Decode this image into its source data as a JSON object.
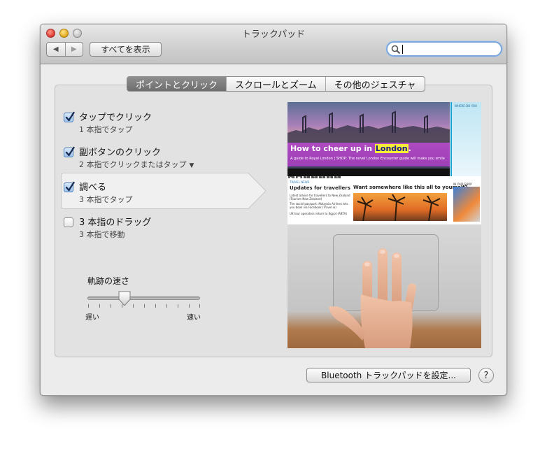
{
  "window": {
    "title": "トラックパッド"
  },
  "toolbar": {
    "show_all_label": "すべてを表示",
    "back_label": "◀",
    "forward_label": "▶"
  },
  "search": {
    "value": "",
    "placeholder": ""
  },
  "tabs": [
    {
      "label": "ポイントとクリック",
      "active": true
    },
    {
      "label": "スクロールとズーム",
      "active": false
    },
    {
      "label": "その他のジェスチャ",
      "active": false
    }
  ],
  "options": [
    {
      "title": "タップでクリック",
      "subtitle": "1 本指でタップ",
      "checked": true,
      "has_menu": false
    },
    {
      "title": "副ボタンのクリック",
      "subtitle": "2 本指でクリックまたはタップ",
      "checked": true,
      "has_menu": true
    },
    {
      "title": "調べる",
      "subtitle": "3 本指でタップ",
      "checked": true,
      "has_menu": false
    },
    {
      "title": "3 本指のドラッグ",
      "subtitle": "3 本指で移動",
      "checked": false,
      "has_menu": false
    }
  ],
  "slider": {
    "label": "軌跡の速さ",
    "min_label": "遅い",
    "max_label": "速い",
    "value_fraction": 0.33
  },
  "preview": {
    "headline_prefix": "How to cheer up in ",
    "headline_highlight": "London",
    "headline_suffix": ".",
    "subline": "A guide to Royal London  |  SHOP: The novel London Encounter guide will make you smile",
    "side_header": "WHERE DO YOU",
    "news_header": "TRAVEL NEWS",
    "news_title": "Updates for travellers",
    "news_items": [
      "Latest advice for travellers to New Zealand (Tourism New Zealand)",
      "The social passport: Malaysia Airlines lets you book via Facebook (Travel.io)",
      "UK tour operators return to Egypt (ABTA)"
    ],
    "want_title": "Want somewhere like this all to yourself?",
    "city_header": "IN OUR SHOP",
    "page_dots": [
      "1",
      "2",
      "3",
      "4",
      "5"
    ]
  },
  "footer": {
    "bluetooth_label": "Bluetooth トラックパッドを設定...",
    "help_label": "?"
  }
}
